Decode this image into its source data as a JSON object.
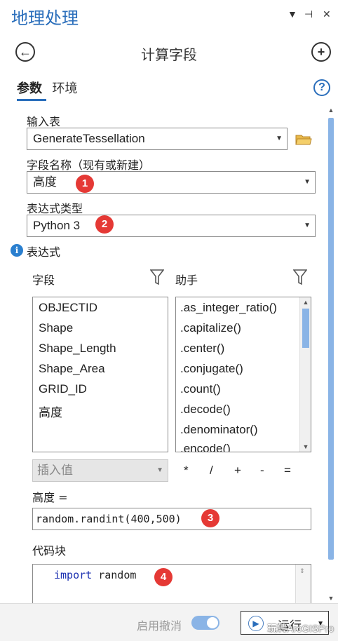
{
  "pane": {
    "title": "地理处理",
    "menu_glyph": "▼",
    "pin_glyph": "⊣",
    "close_glyph": "✕"
  },
  "tool": {
    "title": "计算字段"
  },
  "tabs": [
    {
      "label": "参数"
    },
    {
      "label": "环境"
    }
  ],
  "help_glyph": "?",
  "params": {
    "input_table": {
      "label": "输入表",
      "value": "GenerateTessellation"
    },
    "field_name": {
      "label": "字段名称（现有或新建）",
      "value": "高度"
    },
    "expression_type": {
      "label": "表达式类型",
      "value": "Python 3"
    },
    "expression": {
      "label": "表达式"
    }
  },
  "fields_list": {
    "header": "字段",
    "items": [
      "OBJECTID",
      "Shape",
      "Shape_Length",
      "Shape_Area",
      "GRID_ID",
      "高度"
    ]
  },
  "helpers_list": {
    "header": "助手",
    "items": [
      ".as_integer_ratio()",
      ".capitalize()",
      ".center()",
      ".conjugate()",
      ".count()",
      ".decode()",
      ".denominator()",
      ".encode()"
    ]
  },
  "insert_value": {
    "placeholder": "插入值"
  },
  "operators": [
    "*",
    "/",
    "+",
    "-",
    "="
  ],
  "expression_field": {
    "label": "高度 =",
    "value": "random.randint(400,500)"
  },
  "code_block": {
    "label": "代码块",
    "keyword": "import",
    "rest": " random"
  },
  "annotations": [
    "1",
    "2",
    "3",
    "4"
  ],
  "footer": {
    "undo_label": "启用撤消",
    "undo_enabled": true,
    "run_label": "运行",
    "watermark": "玩转ArcGISPro"
  }
}
